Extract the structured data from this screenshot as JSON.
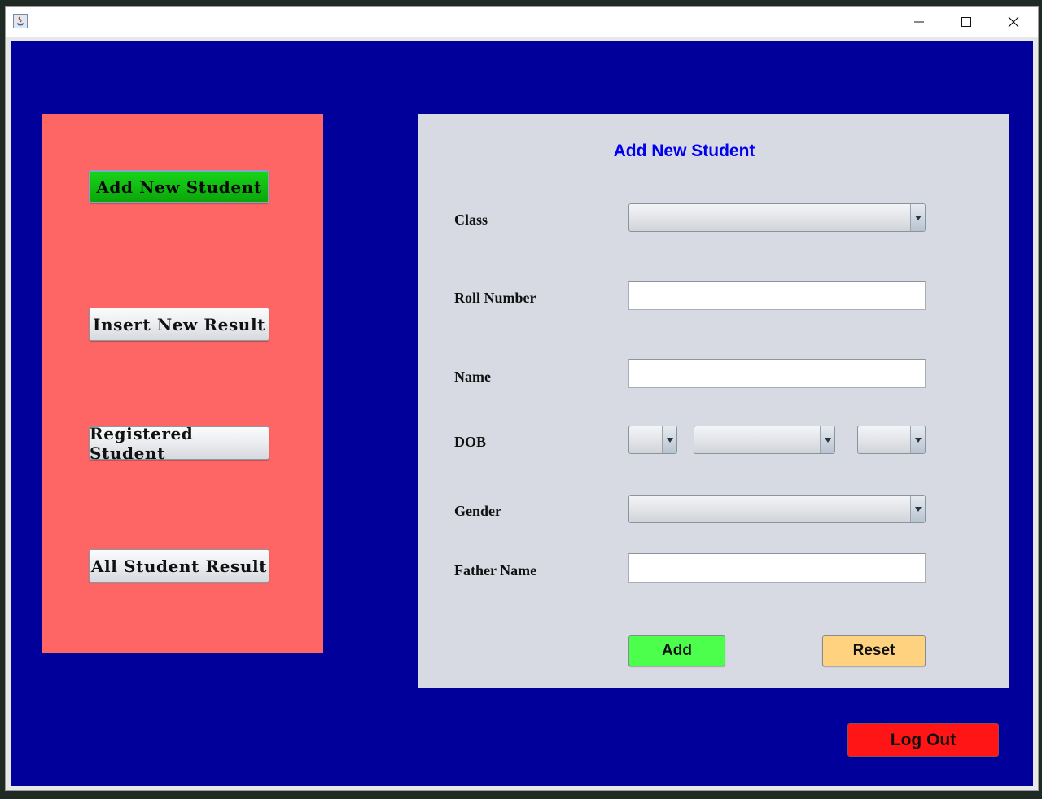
{
  "window": {
    "icon": "java-app-icon",
    "controls": {
      "minimize": "minimize-icon",
      "maximize": "maximize-icon",
      "close": "close-icon"
    }
  },
  "colors": {
    "content_bg": "#02009b",
    "sidebar_bg": "#fe6666",
    "active_nav": "#12bd12",
    "form_bg": "#d7dae2",
    "title_color": "#0000ee",
    "add_button": "#4cff4c",
    "reset_button": "#ffd27f",
    "logout_button": "#ff1515"
  },
  "sidebar": {
    "items": [
      {
        "label": "Add New Student",
        "active": true
      },
      {
        "label": "Insert New Result",
        "active": false
      },
      {
        "label": "Registered Student",
        "active": false
      },
      {
        "label": "All Student Result",
        "active": false
      }
    ]
  },
  "form": {
    "title": "Add New Student",
    "class_label": "Class",
    "class_value": "",
    "roll_label": "Roll Number",
    "roll_value": "",
    "name_label": "Name",
    "name_value": "",
    "dob_label": "DOB",
    "dob_day": "",
    "dob_month": "",
    "dob_year": "",
    "gender_label": "Gender",
    "gender_value": "",
    "father_label": "Father Name",
    "father_value": "",
    "add_label": "Add",
    "reset_label": "Reset"
  },
  "footer": {
    "logout_label": "Log Out"
  }
}
